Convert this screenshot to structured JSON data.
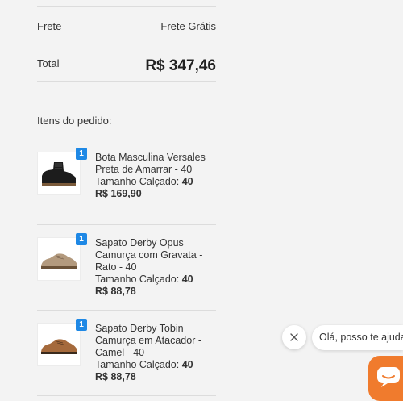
{
  "summary": {
    "shipping_label": "Frete",
    "shipping_value": "Frete Grátis",
    "total_label": "Total",
    "total_value": "R$ 347,46"
  },
  "items_title": "Itens do pedido:",
  "items": [
    {
      "qty": "1",
      "name": "Bota Masculina Versales Preta de Amarrar - 40",
      "size_label": "Tamanho Calçado:",
      "size_value": "40",
      "price": "R$ 169,90",
      "icon": "black-boot-image"
    },
    {
      "qty": "1",
      "name": "Sapato Derby Opus Camurça com Gravata - Rato - 40",
      "size_label": "Tamanho Calçado:",
      "size_value": "40",
      "price": "R$ 88,78",
      "icon": "beige-derby-shoe-image"
    },
    {
      "qty": "1",
      "name": "Sapato Derby Tobin Camurça em Atacador - Camel - 40",
      "size_label": "Tamanho Calçado:",
      "size_value": "40",
      "price": "R$ 88,78",
      "icon": "camel-derby-shoe-image"
    }
  ],
  "chat": {
    "greeting": "Olá, posso te ajudar?",
    "close_icon": "close-icon",
    "chat_icon": "chat-icon",
    "accent": "#f07b2d"
  },
  "colors": {
    "qty_badge": "#1e88e5",
    "background": "#f3f3f3"
  }
}
